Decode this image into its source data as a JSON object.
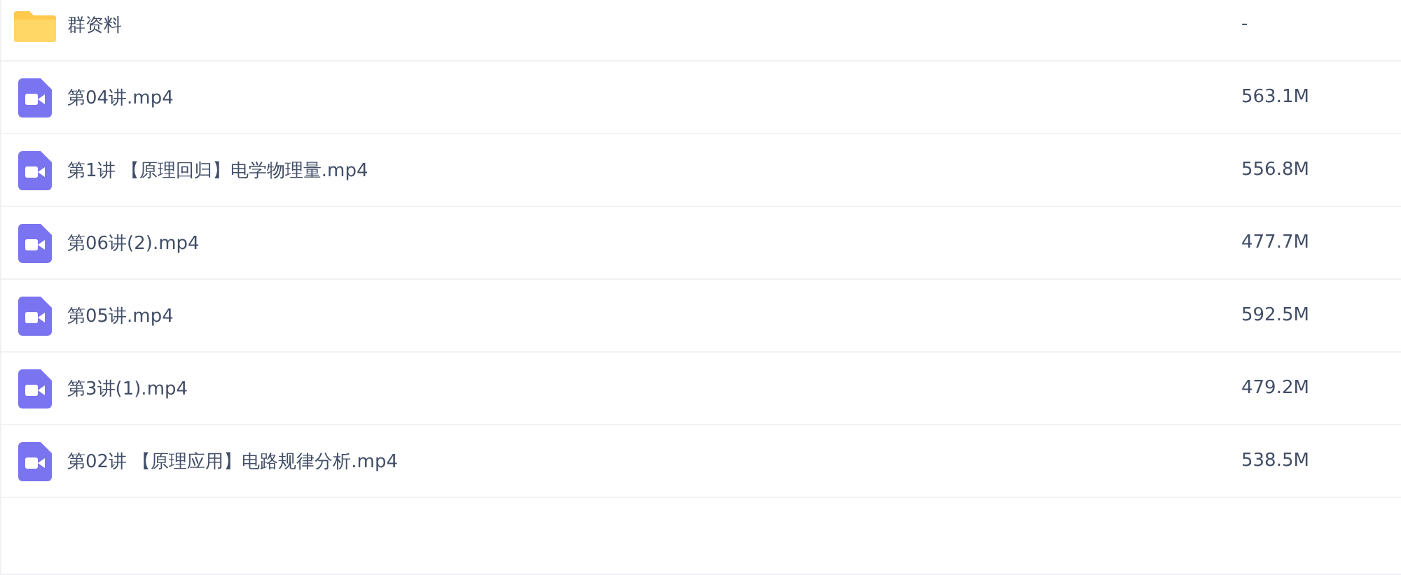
{
  "files": [
    {
      "kind": "folder",
      "name": "群资料",
      "size": "-"
    },
    {
      "kind": "video",
      "name": "第04讲.mp4",
      "size": "563.1M"
    },
    {
      "kind": "video",
      "name": "第1讲 【原理回归】电学物理量.mp4",
      "size": "556.8M"
    },
    {
      "kind": "video",
      "name": "第06讲(2).mp4",
      "size": "477.7M"
    },
    {
      "kind": "video",
      "name": "第05讲.mp4",
      "size": "592.5M"
    },
    {
      "kind": "video",
      "name": "第3讲(1).mp4",
      "size": "479.2M"
    },
    {
      "kind": "video",
      "name": "第02讲 【原理应用】电路规律分析.mp4",
      "size": "538.5M"
    }
  ]
}
